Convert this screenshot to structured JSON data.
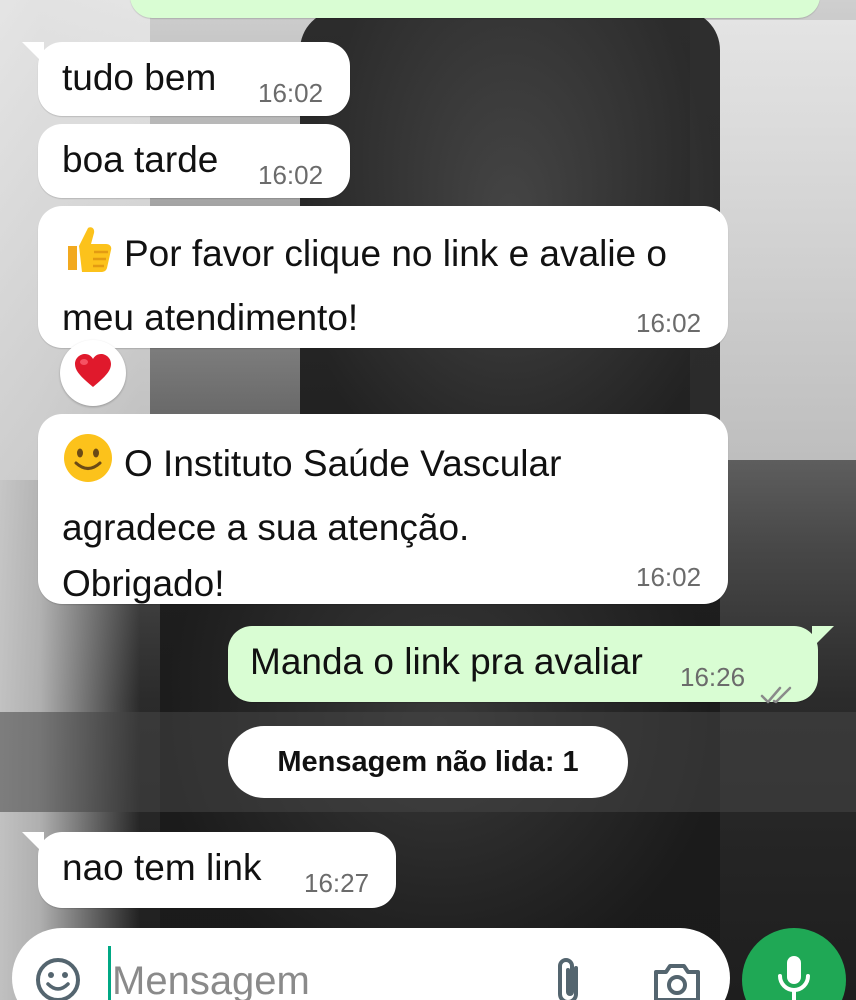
{
  "messages": [
    {
      "direction": "in",
      "text": "tudo bem",
      "time": "16:02"
    },
    {
      "direction": "in",
      "text": "boa tarde",
      "time": "16:02"
    },
    {
      "direction": "in",
      "emoji": "thumbs-up-icon",
      "text": "Por favor clique no link e avalie o meu atendimento!",
      "time": "16:02",
      "reaction": "heart-icon"
    },
    {
      "direction": "in",
      "emoji": "smiling-face-icon",
      "text": "O Instituto Saúde Vascular agradece a sua atenção. Obrigado!",
      "time": "16:02"
    },
    {
      "direction": "out",
      "text": "Manda o link pra avaliar",
      "time": "16:26",
      "status": "double-check-icon"
    },
    {
      "direction": "in",
      "text": "nao tem link",
      "time": "16:27"
    }
  ],
  "unread_divider": {
    "label": "Mensagem não lida: 1"
  },
  "composer": {
    "placeholder": "Mensagem",
    "emoji_icon": "emoji-icon",
    "attach_icon": "paperclip-icon",
    "camera_icon": "camera-icon",
    "mic_icon": "microphone-icon"
  },
  "colors": {
    "incoming_bubble": "#ffffff",
    "outgoing_bubble": "#d9fdd3",
    "mic_button": "#1fa855",
    "tick": "#8a8a8a"
  }
}
